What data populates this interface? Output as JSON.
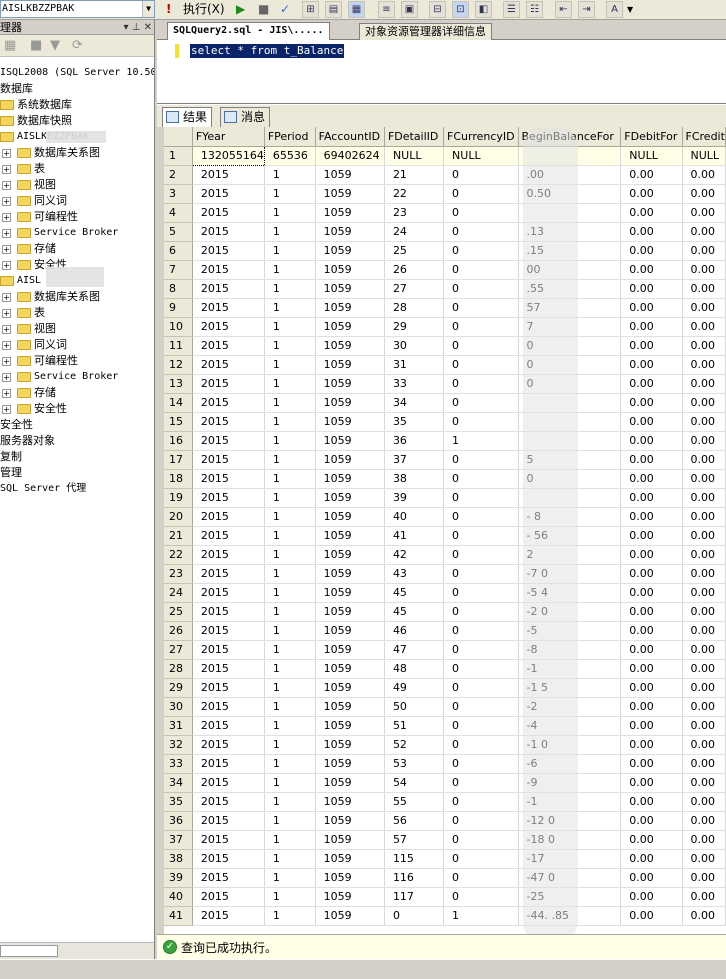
{
  "toolbar": {
    "database": "AISLKBZZPBAK",
    "execute_label": "执行(X)",
    "icons": [
      "run-icon",
      "stop-icon",
      "parse-icon",
      "display-plan-icon",
      "query-options-icon",
      "results-grid-icon",
      "results-text-icon",
      "results-file-icon",
      "comment-icon",
      "uncomment-icon",
      "outdent-icon",
      "indent-icon",
      "specify-values-icon"
    ]
  },
  "object_explorer": {
    "title": "理器",
    "server": "ISQL2008 (SQL Server 10.50",
    "nodes": [
      {
        "label": "数据库",
        "indent": 0,
        "expand": "",
        "folder": false
      },
      {
        "label": "系统数据库",
        "indent": 1,
        "expand": "+",
        "folder": true
      },
      {
        "label": "数据库快照",
        "indent": 1,
        "expand": "+",
        "folder": true
      },
      {
        "label": "AISLKBZZPBAK",
        "indent": 1,
        "expand": "-",
        "folder": true
      },
      {
        "label": "数据库关系图",
        "indent": 2,
        "expand": "+",
        "folder": true
      },
      {
        "label": "表",
        "indent": 2,
        "expand": "+",
        "folder": true
      },
      {
        "label": "视图",
        "indent": 2,
        "expand": "+",
        "folder": true
      },
      {
        "label": "同义词",
        "indent": 2,
        "expand": "+",
        "folder": true
      },
      {
        "label": "可编程性",
        "indent": 2,
        "expand": "+",
        "folder": true
      },
      {
        "label": "Service Broker",
        "indent": 2,
        "expand": "+",
        "folder": true
      },
      {
        "label": "存储",
        "indent": 2,
        "expand": "+",
        "folder": true
      },
      {
        "label": "安全性",
        "indent": 2,
        "expand": "+",
        "folder": true
      },
      {
        "label": "AISL",
        "indent": 1,
        "expand": "-",
        "folder": true
      },
      {
        "label": "数据库关系图",
        "indent": 2,
        "expand": "+",
        "folder": true
      },
      {
        "label": "表",
        "indent": 2,
        "expand": "+",
        "folder": true
      },
      {
        "label": "视图",
        "indent": 2,
        "expand": "+",
        "folder": true
      },
      {
        "label": "同义词",
        "indent": 2,
        "expand": "+",
        "folder": true
      },
      {
        "label": "可编程性",
        "indent": 2,
        "expand": "+",
        "folder": true
      },
      {
        "label": "Service Broker",
        "indent": 2,
        "expand": "+",
        "folder": true
      },
      {
        "label": "存储",
        "indent": 2,
        "expand": "+",
        "folder": true
      },
      {
        "label": "安全性",
        "indent": 2,
        "expand": "+",
        "folder": true
      },
      {
        "label": "安全性",
        "indent": 0,
        "expand": "",
        "folder": false
      },
      {
        "label": "服务器对象",
        "indent": 0,
        "expand": "",
        "folder": false
      },
      {
        "label": "复制",
        "indent": 0,
        "expand": "",
        "folder": false
      },
      {
        "label": "管理",
        "indent": 0,
        "expand": "",
        "folder": false
      },
      {
        "label": "SQL Server 代理",
        "indent": 0,
        "expand": "",
        "folder": false
      }
    ]
  },
  "doc_tabs": [
    {
      "label": "SQLQuery2.sql - JIS\\.....",
      "active": true
    },
    {
      "label": "对象资源管理器详细信息",
      "active": false
    }
  ],
  "editor": {
    "sql": "select * from t_Balance"
  },
  "result_tabs": [
    {
      "label": "结果",
      "active": true
    },
    {
      "label": "消息",
      "active": false
    }
  ],
  "grid": {
    "columns": [
      "",
      "FYear",
      "FPeriod",
      "FAccountID",
      "FDetailID",
      "FCurrencyID",
      "BeginBalanceFor",
      "FDebitFor",
      "FCredit"
    ],
    "rows": [
      [
        "1",
        "132055164",
        "65536",
        "69402624",
        "NULL",
        "NULL",
        "",
        "NULL",
        "NULL"
      ],
      [
        "2",
        "2015",
        "1",
        "1059",
        "21",
        "0",
        ".00",
        "0.00",
        "0.00"
      ],
      [
        "3",
        "2015",
        "1",
        "1059",
        "22",
        "0",
        "0.50",
        "0.00",
        "0.00"
      ],
      [
        "4",
        "2015",
        "1",
        "1059",
        "23",
        "0",
        "",
        "0.00",
        "0.00"
      ],
      [
        "5",
        "2015",
        "1",
        "1059",
        "24",
        "0",
        ".13",
        "0.00",
        "0.00"
      ],
      [
        "6",
        "2015",
        "1",
        "1059",
        "25",
        "0",
        ".15",
        "0.00",
        "0.00"
      ],
      [
        "7",
        "2015",
        "1",
        "1059",
        "26",
        "0",
        "00",
        "0.00",
        "0.00"
      ],
      [
        "8",
        "2015",
        "1",
        "1059",
        "27",
        "0",
        ".55",
        "0.00",
        "0.00"
      ],
      [
        "9",
        "2015",
        "1",
        "1059",
        "28",
        "0",
        "57",
        "0.00",
        "0.00"
      ],
      [
        "10",
        "2015",
        "1",
        "1059",
        "29",
        "0",
        "7",
        "0.00",
        "0.00"
      ],
      [
        "11",
        "2015",
        "1",
        "1059",
        "30",
        "0",
        "0",
        "0.00",
        "0.00"
      ],
      [
        "12",
        "2015",
        "1",
        "1059",
        "31",
        "0",
        "0",
        "0.00",
        "0.00"
      ],
      [
        "13",
        "2015",
        "1",
        "1059",
        "33",
        "0",
        "0",
        "0.00",
        "0.00"
      ],
      [
        "14",
        "2015",
        "1",
        "1059",
        "34",
        "0",
        "",
        "0.00",
        "0.00"
      ],
      [
        "15",
        "2015",
        "1",
        "1059",
        "35",
        "0",
        "",
        "0.00",
        "0.00"
      ],
      [
        "16",
        "2015",
        "1",
        "1059",
        "36",
        "1",
        "",
        "0.00",
        "0.00"
      ],
      [
        "17",
        "2015",
        "1",
        "1059",
        "37",
        "0",
        "5",
        "0.00",
        "0.00"
      ],
      [
        "18",
        "2015",
        "1",
        "1059",
        "38",
        "0",
        "0",
        "0.00",
        "0.00"
      ],
      [
        "19",
        "2015",
        "1",
        "1059",
        "39",
        "0",
        "",
        "0.00",
        "0.00"
      ],
      [
        "20",
        "2015",
        "1",
        "1059",
        "40",
        "0",
        "-      8",
        "0.00",
        "0.00"
      ],
      [
        "21",
        "2015",
        "1",
        "1059",
        "41",
        "0",
        "-      56",
        "0.00",
        "0.00"
      ],
      [
        "22",
        "2015",
        "1",
        "1059",
        "42",
        "0",
        "2",
        "0.00",
        "0.00"
      ],
      [
        "23",
        "2015",
        "1",
        "1059",
        "43",
        "0",
        "-7     0",
        "0.00",
        "0.00"
      ],
      [
        "24",
        "2015",
        "1",
        "1059",
        "45",
        "0",
        "-5     4",
        "0.00",
        "0.00"
      ],
      [
        "25",
        "2015",
        "1",
        "1059",
        "45",
        "0",
        "-2     0",
        "0.00",
        "0.00"
      ],
      [
        "26",
        "2015",
        "1",
        "1059",
        "46",
        "0",
        "-5",
        "0.00",
        "0.00"
      ],
      [
        "27",
        "2015",
        "1",
        "1059",
        "47",
        "0",
        "-8",
        "0.00",
        "0.00"
      ],
      [
        "28",
        "2015",
        "1",
        "1059",
        "48",
        "0",
        "-1",
        "0.00",
        "0.00"
      ],
      [
        "29",
        "2015",
        "1",
        "1059",
        "49",
        "0",
        "-1     5",
        "0.00",
        "0.00"
      ],
      [
        "30",
        "2015",
        "1",
        "1059",
        "50",
        "0",
        "-2",
        "0.00",
        "0.00"
      ],
      [
        "31",
        "2015",
        "1",
        "1059",
        "51",
        "0",
        "-4",
        "0.00",
        "0.00"
      ],
      [
        "32",
        "2015",
        "1",
        "1059",
        "52",
        "0",
        "-1     0",
        "0.00",
        "0.00"
      ],
      [
        "33",
        "2015",
        "1",
        "1059",
        "53",
        "0",
        "-6",
        "0.00",
        "0.00"
      ],
      [
        "34",
        "2015",
        "1",
        "1059",
        "54",
        "0",
        "-9",
        "0.00",
        "0.00"
      ],
      [
        "35",
        "2015",
        "1",
        "1059",
        "55",
        "0",
        "-1",
        "0.00",
        "0.00"
      ],
      [
        "36",
        "2015",
        "1",
        "1059",
        "56",
        "0",
        "-12    0",
        "0.00",
        "0.00"
      ],
      [
        "37",
        "2015",
        "1",
        "1059",
        "57",
        "0",
        "-18    0",
        "0.00",
        "0.00"
      ],
      [
        "38",
        "2015",
        "1",
        "1059",
        "115",
        "0",
        "-17",
        "0.00",
        "0.00"
      ],
      [
        "39",
        "2015",
        "1",
        "1059",
        "116",
        "0",
        "-47    0",
        "0.00",
        "0.00"
      ],
      [
        "40",
        "2015",
        "1",
        "1059",
        "117",
        "0",
        "-25",
        "0.00",
        "0.00"
      ],
      [
        "41",
        "2015",
        "1",
        "1059",
        "0",
        "1",
        "-44.   .85",
        "0.00",
        "0.00"
      ]
    ]
  },
  "status": {
    "message": "查询已成功执行。"
  }
}
